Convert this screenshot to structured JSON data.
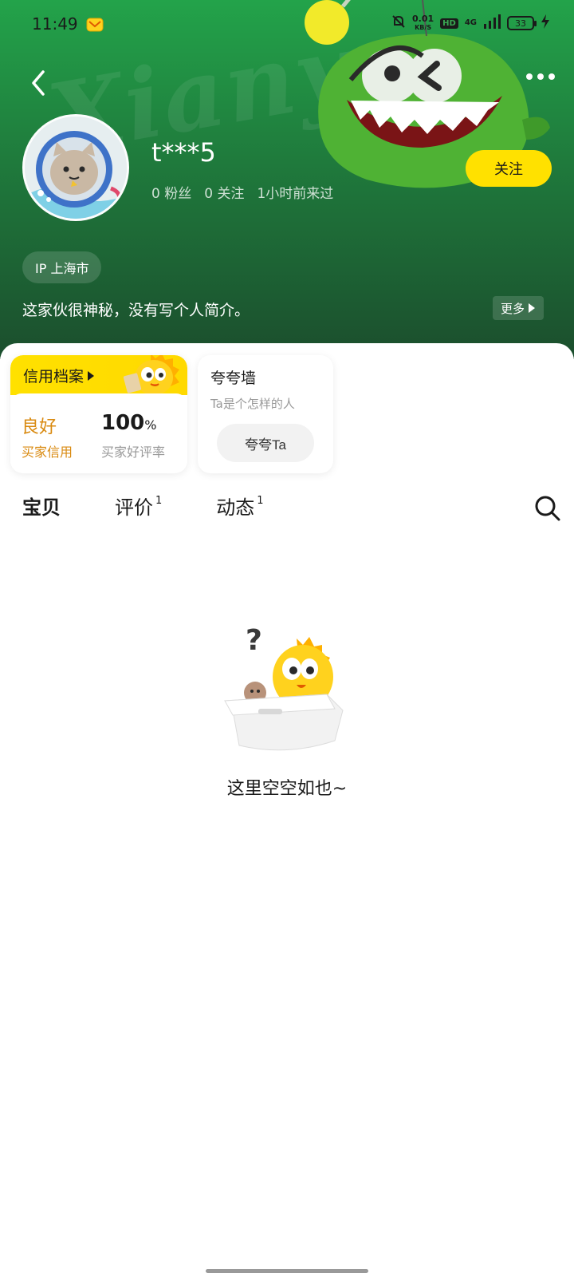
{
  "status_bar": {
    "time": "11:49",
    "net_speed_value": "0.01",
    "net_speed_unit": "KB/S",
    "hd_label": "HD",
    "signal_label": "4G",
    "battery": "33"
  },
  "header": {
    "watermark": "Xianyu",
    "username": "t***5",
    "stats": {
      "fans": "0 粉丝",
      "following": "0 关注",
      "last_seen": "1小时前来过"
    },
    "follow_label": "关注",
    "ip_label": "IP 上海市",
    "bio": "这家伙很神秘，没有写个人简介。",
    "more_label": "更多"
  },
  "credit_card": {
    "title": "信用档案",
    "status": "良好",
    "status_label": "买家信用",
    "rate_value": "100",
    "rate_unit": "%",
    "rate_label": "买家好评率"
  },
  "praise_card": {
    "title": "夸夸墙",
    "subtitle": "Ta是个怎样的人",
    "button_label": "夸夸Ta"
  },
  "tabs": [
    {
      "label": "宝贝",
      "count": "",
      "active": true
    },
    {
      "label": "评价",
      "count": "1",
      "active": false
    },
    {
      "label": "动态",
      "count": "1",
      "active": false
    }
  ],
  "empty_state": {
    "text": "这里空空如也~"
  },
  "colors": {
    "accent_yellow": "#ffe100",
    "header_green": "#1f7a3c",
    "credit_orange": "#d98a10"
  }
}
